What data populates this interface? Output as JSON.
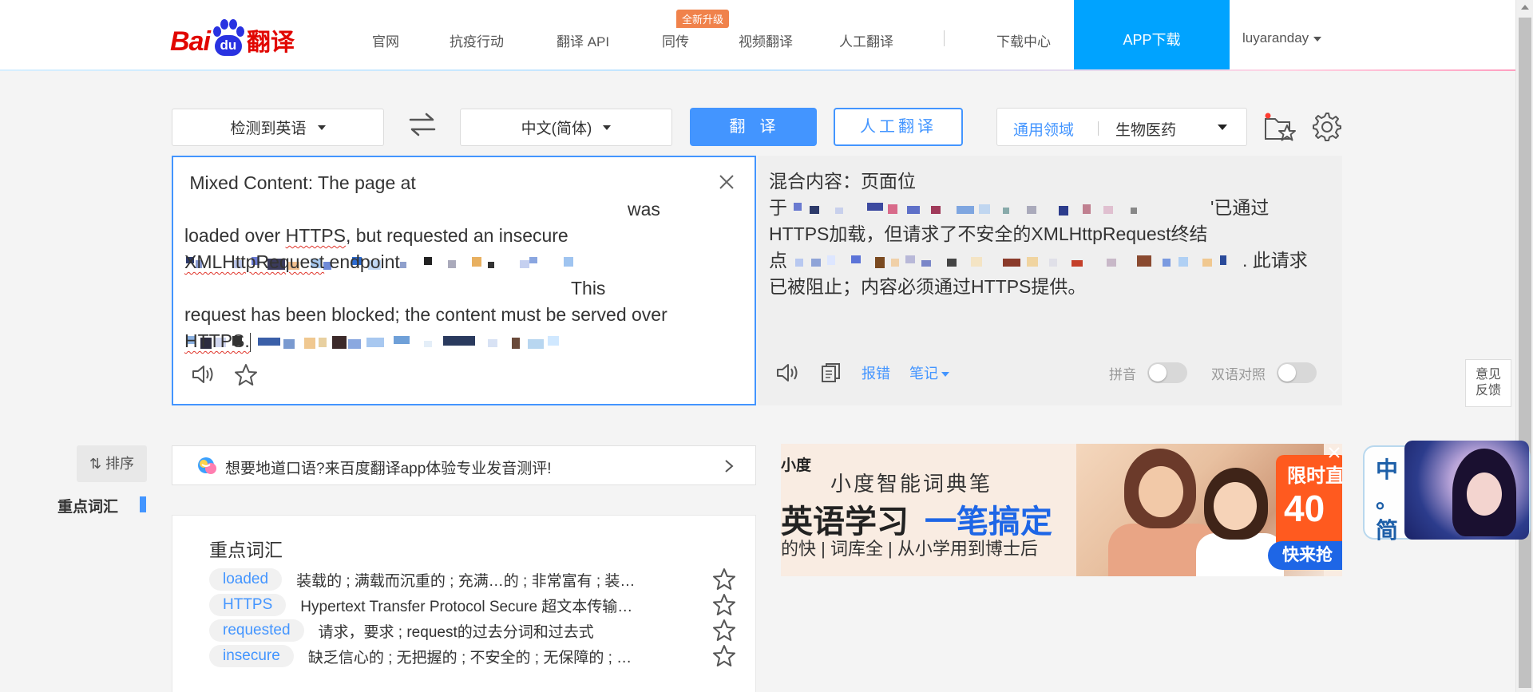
{
  "header": {
    "nav": [
      "官网",
      "抗疫行动",
      "翻译 API",
      "同传",
      "视频翻译",
      "人工翻译",
      "下载中心"
    ],
    "badge": "全新升级",
    "app_download": "APP下载",
    "user": "luyaranday"
  },
  "toolbar": {
    "source_lang": "检测到英语",
    "target_lang": "中文(简体)",
    "translate_btn": "翻译",
    "human_btn": "人工翻译",
    "domain_general": "通用领域",
    "domain_specific": "生物医药"
  },
  "source": {
    "line1": "Mixed Content: The page at",
    "was": "was",
    "mid_pre": "loaded over ",
    "https1": "HTTPS",
    "mid_post": ", but requested an insecure",
    "xhr": "XMLHttpRequest",
    "endpoint": " endpoint",
    "this": "This",
    "tail": "request has been blocked; the content must be served over",
    "https2": "HTTPS."
  },
  "target": {
    "line1": "混合内容：页面位",
    "l2_prefix": "于",
    "l2_suffix": "'已通过",
    "line3": "HTTPS加载，但请求了不安全的XMLHttpRequest终结",
    "l4_prefix": "点",
    "l4_suffix": ". 此请求",
    "line5": "已被阻止；内容必须通过HTTPS提供。"
  },
  "target_tools": {
    "report": "报错",
    "notes": "笔记",
    "pinyin": "拼音",
    "bilingual": "双语对照"
  },
  "feedback": [
    "意见",
    "反馈"
  ],
  "sidebar": {
    "sort": "排序",
    "key_vocab": "重点词汇"
  },
  "promo": {
    "text": "想要地道口语?来百度翻译app体验专业发音测评!"
  },
  "vocab": {
    "title": "重点词汇",
    "items": [
      {
        "word": "loaded",
        "def": "装载的 ; 满载而沉重的 ; 充满…的 ; 非常富有 ; 装…"
      },
      {
        "word": "HTTPS",
        "def": "Hypertext Transfer Protocol Secure 超文本传输…"
      },
      {
        "word": "requested",
        "def": "请求，要求 ; request的过去分词和过去式"
      },
      {
        "word": "insecure",
        "def": "缺乏信心的 ; 无把握的 ; 不安全的 ; 无保障的 ; …"
      }
    ]
  },
  "ad": {
    "brand": "小度",
    "sub": "小度智能词典笔",
    "head1": "英语学习",
    "head2": "一笔搞定",
    "tagline": "的快 | 词库全 | 从小学用到博士后",
    "badge_top": "限时直",
    "badge_num": "40",
    "cta": "快来抢"
  },
  "widget": {
    "chars": [
      "中",
      "。",
      "简"
    ]
  },
  "colors": {
    "accent": "#4395ff",
    "brand_red": "#e10601",
    "app_blue": "#00a3ff"
  }
}
